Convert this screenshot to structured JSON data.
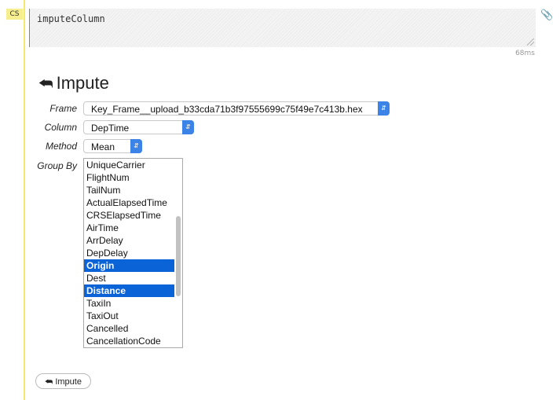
{
  "cell": {
    "badge": "CS",
    "code": "imputeColumn",
    "elapsed": "68ms"
  },
  "form": {
    "title": "Impute",
    "frame_label": "Frame",
    "frame_value": "Key_Frame__upload_b33cda71b3f97555699c75f49e7c413b.hex",
    "column_label": "Column",
    "column_value": "DepTime",
    "method_label": "Method",
    "method_value": "Mean",
    "group_by_label": "Group By",
    "group_by_options": [
      {
        "label": "UniqueCarrier",
        "selected": false
      },
      {
        "label": "FlightNum",
        "selected": false
      },
      {
        "label": "TailNum",
        "selected": false
      },
      {
        "label": "ActualElapsedTime",
        "selected": false
      },
      {
        "label": "CRSElapsedTime",
        "selected": false
      },
      {
        "label": "AirTime",
        "selected": false
      },
      {
        "label": "ArrDelay",
        "selected": false
      },
      {
        "label": "DepDelay",
        "selected": false
      },
      {
        "label": "Origin",
        "selected": true
      },
      {
        "label": "Dest",
        "selected": false
      },
      {
        "label": "Distance",
        "selected": true
      },
      {
        "label": "TaxiIn",
        "selected": false
      },
      {
        "label": "TaxiOut",
        "selected": false
      },
      {
        "label": "Cancelled",
        "selected": false
      },
      {
        "label": "CancellationCode",
        "selected": false
      }
    ],
    "submit_label": "Impute"
  },
  "colors": {
    "gutter": "#f5e96b",
    "select_accent": "#3b83e6",
    "selected_option": "#0b63d8"
  }
}
